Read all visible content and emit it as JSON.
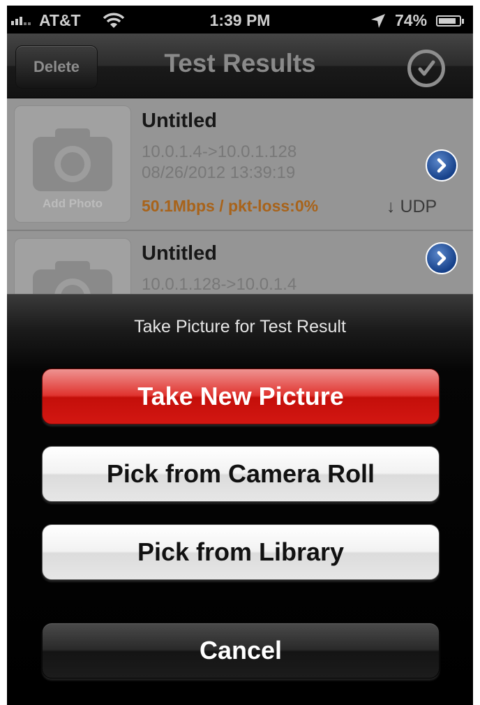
{
  "status_bar": {
    "carrier": "AT&T",
    "time": "1:39 PM",
    "battery_percent": "74%",
    "icons": [
      "signal-icon",
      "wifi-icon",
      "location-arrow-icon",
      "battery-icon"
    ]
  },
  "nav_bar": {
    "delete_label": "Delete",
    "title": "Test Results",
    "done_icon": "checkmark-circle-icon"
  },
  "results": [
    {
      "name": "Untitled",
      "add_photo_label": "Add Photo",
      "route": "10.0.1.4->10.0.1.128",
      "date": "08/26/2012 13:39:19",
      "rate": "50.1Mbps / pkt-loss:0%",
      "protocol": "↓ UDP"
    },
    {
      "name": "Untitled",
      "route": "10.0.1.128->10.0.1.4"
    }
  ],
  "action_sheet": {
    "title": "Take Picture for Test Result",
    "take_new_label": "Take New Picture",
    "camera_roll_label": "Pick from Camera Roll",
    "library_label": "Pick from Library",
    "cancel_label": "Cancel"
  },
  "colors": {
    "destructive_red": "#d31712",
    "rate_orange": "#a8631a",
    "disclosure_blue": "#1e4a92"
  }
}
